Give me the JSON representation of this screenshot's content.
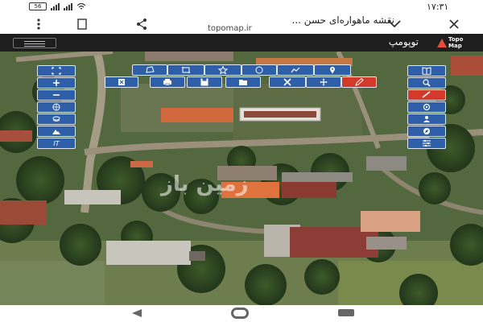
{
  "status_bar": {
    "time": "١٧:٣١",
    "battery": "56"
  },
  "browser": {
    "page_title": "نقشه ماهواره‌ای حسن ...",
    "url": "topomap.ir"
  },
  "app_header": {
    "brand": "توپومپ",
    "logo_text_line1": "Topo",
    "logo_text_line2": "Map"
  },
  "map": {
    "watermark": "زمین باز"
  },
  "toolbar": {
    "scale_label": "IT"
  },
  "colors": {
    "toolbar_blue": "#2e5fa8",
    "active_red": "#d33a2c",
    "header_dark": "#1e1e1e"
  }
}
